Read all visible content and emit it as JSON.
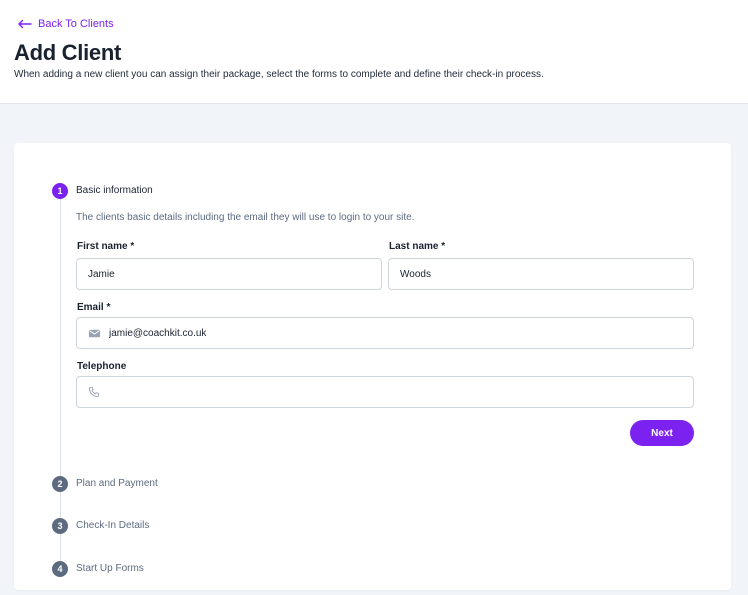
{
  "header": {
    "back_label": "Back To Clients",
    "title": "Add Client",
    "description": "When adding a new client you can assign their package, select the forms to complete and define their check-in process."
  },
  "steps": [
    {
      "number": "1",
      "title": "Basic information",
      "state": "active"
    },
    {
      "number": "2",
      "title": "Plan and Payment",
      "state": "inactive"
    },
    {
      "number": "3",
      "title": "Check-In Details",
      "state": "inactive"
    },
    {
      "number": "4",
      "title": "Start Up Forms",
      "state": "inactive"
    }
  ],
  "basic_info": {
    "description": "The clients basic details including the email they will use to login to your site.",
    "first_name": {
      "label": "First name *",
      "value": "Jamie"
    },
    "last_name": {
      "label": "Last name *",
      "value": "Woods"
    },
    "email": {
      "label": "Email *",
      "value": "jamie@coachkit.co.uk",
      "icon": "envelope-icon"
    },
    "telephone": {
      "label": "Telephone",
      "value": "",
      "icon": "phone-icon"
    },
    "next_label": "Next"
  },
  "colors": {
    "accent": "#7c22f0",
    "inactive_step": "#5d6b80",
    "page_bg": "#f1f4f8"
  }
}
